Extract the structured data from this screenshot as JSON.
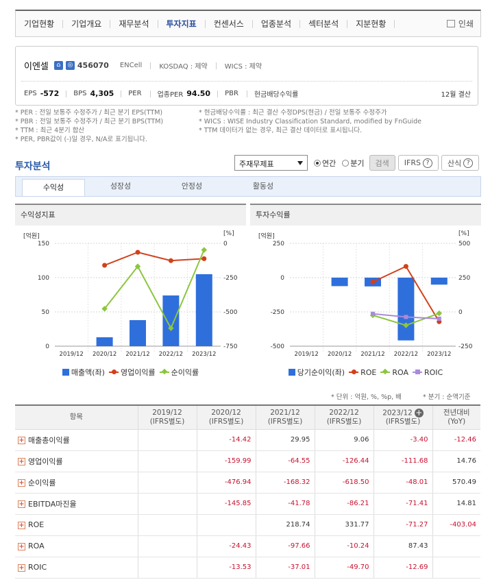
{
  "nav": {
    "tabs": [
      "기업현황",
      "기업개요",
      "재무분석",
      "투자지표",
      "컨센서스",
      "업종분석",
      "섹터분석",
      "지분현황"
    ],
    "active_index": 3,
    "print_label": "인쇄"
  },
  "company": {
    "name": "이엔셀",
    "code": "456070",
    "english": "ENCell",
    "market": "KOSDAQ : 제약",
    "wics": "WICS : 제약",
    "eps_label": "EPS",
    "eps_value": "-572",
    "bps_label": "BPS",
    "bps_value": "4,305",
    "per_label": "PER",
    "sector_per_label": "업종PER",
    "sector_per_value": "94.50",
    "pbr_label": "PBR",
    "dividend_label": "현금배당수익률",
    "fiscal": "12월 결산"
  },
  "notes": {
    "left": [
      "* PER : 전일 보통주 수정주가 / 최근 분기 EPS(TTM)",
      "* PBR : 전일 보통주 수정주가 / 최근 분기 BPS(TTM)",
      "* TTM : 최근 4분기 합산",
      "* PER, PBR값이 (-)일 경우, N/A로 표기됩니다."
    ],
    "right": [
      "* 현금배당수익률 : 최근 결산 수정DPS(현금) / 전일 보통주 수정주가",
      "* WICS : WISE Industry Classification Standard, modified by FnGuide",
      "* TTM 데이터가 없는 경우, 최근 결산 데이터로 표시됩니다."
    ]
  },
  "section": {
    "title": "투자분석",
    "select_value": "주재무제표",
    "radio_annual": "연간",
    "radio_quarter": "분기",
    "search_button": "검색",
    "ifrs_button": "IFRS",
    "formula_button": "산식"
  },
  "subtabs": [
    "수익성",
    "성장성",
    "안정성",
    "활동성"
  ],
  "charts": {
    "left_title": "수익성지표",
    "right_title": "투자수익률"
  },
  "colors": {
    "bar": "#2f6fdc",
    "red": "#d2401c",
    "green": "#8cc63f",
    "purple": "#a98bd9",
    "negative": "#c8102e"
  },
  "chart_data": [
    {
      "type": "bar",
      "categories": [
        "2019/12",
        "2020/12",
        "2021/12",
        "2022/12",
        "2023/12"
      ],
      "left_unit": "[억원]",
      "right_unit": "[%]",
      "left_ticks": [
        "150",
        "100",
        "50",
        "0"
      ],
      "right_ticks": [
        "0",
        "-250",
        "-500",
        "-750"
      ],
      "ylim_left": [
        0,
        150
      ],
      "ylim_right": [
        -750,
        0
      ],
      "series": [
        {
          "name": "매출액(좌)",
          "axis": "left",
          "kind": "bar",
          "values": [
            null,
            13,
            38,
            74,
            105
          ]
        },
        {
          "name": "영업이익률",
          "axis": "right",
          "kind": "line",
          "values": [
            null,
            -160,
            -65,
            -126,
            -112
          ]
        },
        {
          "name": "순이익률",
          "axis": "right",
          "kind": "line",
          "values": [
            null,
            -477,
            -168,
            -619,
            -48
          ]
        }
      ]
    },
    {
      "type": "bar",
      "categories": [
        "2019/12",
        "2020/12",
        "2021/12",
        "2022/12",
        "2023/12"
      ],
      "left_unit": "[억원]",
      "right_unit": "[%]",
      "left_ticks": [
        "250",
        "0",
        "-250",
        "-500"
      ],
      "right_ticks": [
        "500",
        "250",
        "0",
        "-250"
      ],
      "ylim_left": [
        -500,
        250
      ],
      "ylim_right": [
        -250,
        500
      ],
      "series": [
        {
          "name": "당기순이익(좌)",
          "axis": "left",
          "kind": "bar",
          "values": [
            null,
            -62,
            -64,
            -458,
            -51
          ]
        },
        {
          "name": "ROE",
          "axis": "right",
          "kind": "line",
          "values": [
            null,
            null,
            218.74,
            331.77,
            -71.27
          ]
        },
        {
          "name": "ROA",
          "axis": "right",
          "kind": "line",
          "values": [
            null,
            null,
            -24.43,
            -97.66,
            -10.24
          ]
        },
        {
          "name": "ROIC",
          "axis": "right",
          "kind": "line",
          "values": [
            null,
            null,
            -13.53,
            -37.01,
            -49.7
          ]
        }
      ]
    }
  ],
  "units": {
    "unit_note": "* 단위 : 억원, %, %p, 배",
    "quarter_note": "* 분기 : 순액기준"
  },
  "table": {
    "headers": [
      {
        "l1": "항목",
        "l2": ""
      },
      {
        "l1": "2019/12",
        "l2": "(IFRS별도)"
      },
      {
        "l1": "2020/12",
        "l2": "(IFRS별도)"
      },
      {
        "l1": "2021/12",
        "l2": "(IFRS별도)"
      },
      {
        "l1": "2022/12",
        "l2": "(IFRS별도)"
      },
      {
        "l1": "2023/12",
        "l2": "(IFRS별도)"
      },
      {
        "l1": "전년대비",
        "l2": "(YoY)"
      }
    ],
    "rows": [
      {
        "label": "매출총이익률",
        "values": [
          "",
          "-14.42",
          "29.95",
          "9.06",
          "-3.40",
          "-12.46"
        ]
      },
      {
        "label": "영업이익률",
        "values": [
          "",
          "-159.99",
          "-64.55",
          "-126.44",
          "-111.68",
          "14.76"
        ]
      },
      {
        "label": "순이익률",
        "values": [
          "",
          "-476.94",
          "-168.32",
          "-618.50",
          "-48.01",
          "570.49"
        ]
      },
      {
        "label": "EBITDA마진율",
        "values": [
          "",
          "-145.85",
          "-41.78",
          "-86.21",
          "-71.41",
          "14.81"
        ]
      },
      {
        "label": "ROE",
        "values": [
          "",
          "",
          "218.74",
          "331.77",
          "-71.27",
          "-403.04"
        ]
      },
      {
        "label": "ROA",
        "values": [
          "",
          "-24.43",
          "-97.66",
          "-10.24",
          "87.43",
          ""
        ]
      },
      {
        "label": "ROIC",
        "values": [
          "",
          "-13.53",
          "-37.01",
          "-49.70",
          "-12.69",
          ""
        ]
      }
    ]
  }
}
